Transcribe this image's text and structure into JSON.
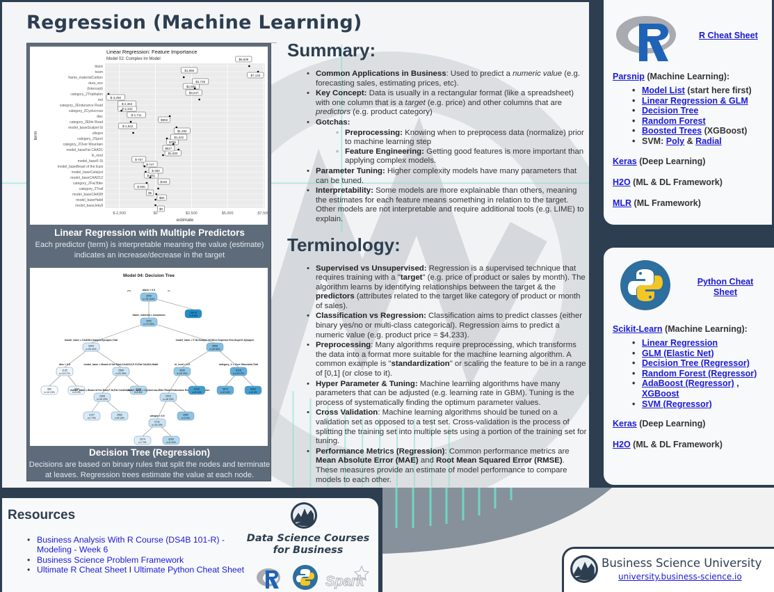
{
  "header": {
    "title": "Regression (Machine Learning)"
  },
  "left_column": {
    "chart_caption_title": "Linear Regression with Multiple Predictors",
    "chart_caption_desc": "Each predictor (term) is interpretable meaning the value (estimate) indicates an increase/decrease in the target",
    "tree_caption_title": "Decision Tree (Regression)",
    "tree_caption_desc": "Decisions are based on binary rules that split the nodes and terminate at leaves. Regression trees estimate the value at each node."
  },
  "chart_data": [
    {
      "type": "scatter",
      "title": "Linear Regression: Feature Importance",
      "subtitle": "Model 02: Complex lm Model",
      "xlabel": "estimate",
      "ylabel": "term",
      "xlim": [
        -3500,
        7600
      ],
      "x_ticks": [
        "$-2,500",
        "$0",
        "$2,500",
        "$5,000",
        "$7,500"
      ],
      "x_tick_values": [
        -2500,
        0,
        2500,
        5000,
        7500
      ],
      "grid": true,
      "terms": [
        "black",
        "team",
        "frame_materialCarbon",
        "dura_ace",
        "(Intercept)",
        "category_2Triathalon",
        "red",
        "category_2Endurance Road",
        "category_2Cyclocross",
        "disc",
        "category_2Elite Road",
        "model_baseScalpel-Si",
        "ultegra",
        "category_2Sport",
        "category_2Over Mountain",
        "model_baseFat CAAD1",
        "hi_mod",
        "model_baseF-Si",
        "model_baseBeast of the East",
        "model_baseCatalyst",
        "model_baseCAAD12",
        "category_2Fat Bike",
        "category_2Trail",
        "model_baseCAAD8",
        "model_baseHabit",
        "model_baseJekyll"
      ],
      "estimates": [
        6509,
        7120,
        1966,
        2860,
        2736,
        -3258,
        3047,
        -2344,
        -2363,
        993,
        -1711,
        1462,
        -1542,
        796,
        1242,
        1600,
        527,
        -747,
        -757,
        -681,
        -360,
        -606,
        194,
        60,
        5,
        0
      ],
      "labels": [
        "$6,509",
        "$7,120",
        "$1,966",
        "$2,860",
        "$2,736",
        "$-3,258",
        "$3,047",
        "$-2,344",
        "$-2,363",
        "$993",
        "$-1,711",
        "$1,462",
        "$-1,542",
        "$796",
        "$1,242",
        "$1,600",
        "$527",
        "$-747",
        "$-757",
        "$-681",
        "$-360",
        "$-606",
        "$194",
        "$60",
        "$5",
        "$0"
      ]
    },
    {
      "type": "tree",
      "title": "Model 04: Decision Tree",
      "nodes": [
        {
          "id": "root",
          "value": "3950",
          "n": "n=78  100%",
          "split": "black < 0.5",
          "yes": "yes",
          "no": "no",
          "shade": 0.5
        },
        {
          "id": "n2",
          "value": "3442",
          "n": "n=72  92%",
          "split": "frame_material = Aluminum",
          "shade": 0.45
        },
        {
          "id": "n3",
          "value": "10e+3",
          "n": "n=6  8%",
          "shade": 1.0
        },
        {
          "id": "n4",
          "value": "2004",
          "n": "n=33  42%",
          "split": "model_base = CAAD8,Catalyst,Synapse,Trail",
          "shade": 0.15
        },
        {
          "id": "n5",
          "value": "4658",
          "n": "n=39  50%",
          "split": "model_base = F-Si,Scalpel 29,Slice,Supersix Evo,SuperX,Synapse",
          "shade": 0.55
        },
        {
          "id": "n8",
          "value": "1135",
          "n": "n=13  17%",
          "split": "disc < 0.5",
          "shade": 0.05
        },
        {
          "id": "n9",
          "value": "2569",
          "n": "n=20  26%",
          "split": "model_base = Beast of the East,CAAD12,F-Si,Fat CAAD2,Habit",
          "shade": 0.2
        },
        {
          "id": "n10",
          "value": "3930",
          "n": "n=26  33%",
          "split": "hi_mod < 0.5",
          "shade": 0.45
        },
        {
          "id": "n11",
          "value": "6116",
          "n": "n=13  17%",
          "split": "category_2 = Over Mountain,Trail",
          "shade": 0.7
        },
        {
          "id": "n16",
          "value": "980",
          "n": "n=10  13%",
          "shade": 0.0
        },
        {
          "id": "n17",
          "value": "1650",
          "n": "n=3  4%",
          "shade": 0.05
        },
        {
          "id": "n18",
          "value": "2308",
          "n": "n=15  19%",
          "split": "model_base = Beast of the East,F-Si,Fat CAAD2,Habit",
          "shade": 0.18
        },
        {
          "id": "n19",
          "value": "3198",
          "n": "n=5  6%",
          "shade": 0.3
        },
        {
          "id": "n20",
          "value": "2923",
          "n": "n=18  23%",
          "split": "model_base = Cyclocross,Elite Road,Endurance Road,Sport,Triathlon",
          "shade": 0.25
        },
        {
          "id": "n21",
          "value": "6190",
          "n": "n=8  10%",
          "shade": 0.85
        },
        {
          "id": "n22",
          "value": "5874",
          "n": "n=8  10%",
          "shade": 0.7
        },
        {
          "id": "n23",
          "value": "6500",
          "n": "n=5  6%",
          "shade": 0.85
        },
        {
          "id": "n36",
          "value": "2127",
          "n": "n=7  9%",
          "shade": 0.15
        },
        {
          "id": "n37",
          "value": "2562",
          "n": "n=8  10%",
          "shade": 0.2
        },
        {
          "id": "n40",
          "value": "2711",
          "n": "n=15  19%",
          "split": "ultegra < 0.5",
          "shade": 0.22
        },
        {
          "id": "n41",
          "value": "3980",
          "n": "n=3  4%",
          "shade": 0.5
        },
        {
          "id": "n80",
          "value": "2074",
          "n": "n=7  9%",
          "shade": 0.12
        },
        {
          "id": "n81",
          "value": "3269",
          "n": "n=8  10%",
          "shade": 0.32
        }
      ]
    }
  ],
  "summary": {
    "heading": "Summary:",
    "items": [
      {
        "bold": "Common Applications in Business",
        "text": ": Used to predict a ",
        "italic": "numeric value",
        "text2": " (e.g. forecasting sales, estimating prices, etc)."
      },
      {
        "bold": "Key Concept:",
        "text": " Data is usually in a rectangular format (like a spreadsheet) with one column that is a ",
        "italic": "target",
        "text2": " (e.g. price) and other columns that are ",
        "italic2": "predictors",
        "text3": " (e.g. product category)"
      },
      {
        "bold": "Gotchas:",
        "sub": [
          {
            "bold": "Preprocessing:",
            "text": " Knowing when to preprocess data (normalize) prior to machine learning step"
          },
          {
            "bold": "Feature Engineering:",
            "text": " Getting good features is more important than applying complex models."
          }
        ]
      },
      {
        "bold": "Parameter Tuning:",
        "text": " Higher complexity models have many parameters that can be tuned."
      },
      {
        "bold": "Interpretability:",
        "text": " Some models are more explainable than others, meaning the estimates for each feature means something in relation to the target. Other models are not interpretable and require additional tools (e.g. LIME) to explain."
      }
    ]
  },
  "terminology": {
    "heading": "Terminology:",
    "items": [
      {
        "bold": "Supervised vs Unsupervised:",
        "t1": " Regression is a supervised technique that requires training with a \"",
        "b2": "target",
        "t2": "\" (e.g. price of product or sales by month). The algorithm learns by identifying relationships between the target & the ",
        "b3": "predictors",
        "t3": " (attributes related to the target like category of product or month of sales)."
      },
      {
        "bold": "Classification vs Regression:",
        "t1": " Classification aims to predict classes (either binary yes/no or multi-class categorical). Regression aims to predict a numeric value (e.g. product price = $4,233)."
      },
      {
        "bold": "Preprocessing",
        "t1": ": Many algorithms require preprocessing, which transforms the data into a format more suitable for the machine learning algorithm. A common example is \"",
        "b2": "standardization",
        "t2": "\" or scaling the feature to be in a range of [0,1] (or close to it)."
      },
      {
        "bold": "Hyper Parameter & Tuning:",
        "t1": " Machine learning algorithms have many parameters that can be adjusted (e.g. learning rate in GBM). Tuning is the process of systematically finding the optimum parameter values."
      },
      {
        "bold": "Cross Validation",
        "t1": ": Machine learning algorithms should be tuned on a validation set as opposed to a test set. Cross-validation is the process of splitting the training set into multiple sets using a portion of the training set for tuning."
      },
      {
        "bold": "Performance Metrics (Regression)",
        "t1": ": Common performance metrics are ",
        "b2": "Mean Absolute Error (MAE)",
        "t2": " and ",
        "b3": "Root Mean Squared Error (RMSE)",
        "t3": ". These measures provide an estimate of model performance to compare models to each other."
      }
    ]
  },
  "r_panel": {
    "cheat_sheet_link": "R Cheat Sheet",
    "parsnip_link": "Parsnip",
    "parsnip_suffix": " (Machine Learning):",
    "items": [
      {
        "link": "Model List",
        "suffix": " (start here first)"
      },
      {
        "link": "Linear Regression & GLM",
        "suffix": ""
      },
      {
        "link": "Decision Tree",
        "suffix": ""
      },
      {
        "link": "Random Forest",
        "suffix": ""
      },
      {
        "link": "Boosted Trees",
        "suffix": " (XGBoost)"
      }
    ],
    "svm_prefix": "SVM: ",
    "svm_poly": "Poly",
    "svm_and": " & ",
    "svm_radial": "Radial",
    "keras_link": "Keras",
    "keras_suffix": " (Deep Learning)",
    "h2o_link": "H2O",
    "h2o_suffix": " (ML & DL Framework)",
    "mlr_link": "MLR",
    "mlr_suffix": " (ML Framework)"
  },
  "python_panel": {
    "cheat_sheet_link": "Python Cheat Sheet",
    "sklearn_link": "Scikit-Learn",
    "sklearn_suffix": " (Machine Learning):",
    "items": [
      "Linear Regression",
      "GLM (Elastic Net)",
      "Decision Tree (Regressor)",
      "Random Forest (Regressor)"
    ],
    "adaboost_link": "AdaBoost (Regressor)",
    "adaboost_sep": " , ",
    "xgboost_link": "XGBoost",
    "svm_link": "SVM (Regressor)",
    "keras_link": "Keras",
    "keras_suffix": " (Deep Learning)",
    "h2o_link": "H2O",
    "h2o_suffix": " (ML & DL Framework)"
  },
  "resources": {
    "title": "Resources",
    "links": [
      "Business Analysis With R Course (DS4B 101-R) - Modeling - Week 6",
      "Business Science Problem Framework"
    ],
    "r_cheat": "Ultimate R Cheat Sheet",
    "sep": " I ",
    "py_cheat": "Ultimate Python Cheat Sheet",
    "promo_text": "Data Science Courses for Business"
  },
  "footer": {
    "brand": "Business Science University",
    "url": "university.business-science.io"
  },
  "colors": {
    "navy": "#2c3e50",
    "link": "#1a1ad6",
    "r_blue": "#1f63b6",
    "py_blue": "#2d6f9e",
    "py_yellow": "#f3c623",
    "tree_node": "#4aa3d8"
  }
}
